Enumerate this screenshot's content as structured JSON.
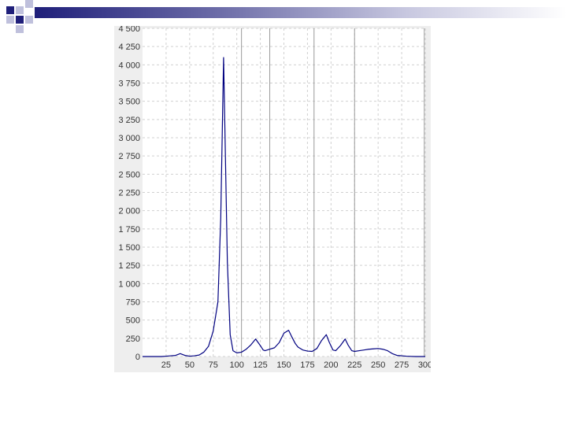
{
  "slide": {
    "decoration": "corner-squares-gradient-bar"
  },
  "colors": {
    "series_line": "#000080",
    "plot_background": "#ffffff",
    "panel_background": "#eeeeee",
    "grid": "#d0d0d0",
    "marker_line": "#999999",
    "decoration_dark": "#1f1f7a",
    "decoration_light": "#bfc0dc"
  },
  "chart_data": {
    "type": "line",
    "title": "",
    "xlabel": "",
    "ylabel": "",
    "xlim": [
      0,
      300
    ],
    "ylim": [
      0,
      4500
    ],
    "grid": true,
    "legend": "none",
    "x_ticks": [
      25,
      50,
      75,
      100,
      125,
      150,
      175,
      200,
      225,
      250,
      275,
      300
    ],
    "x_tick_labels": [
      "25",
      "50",
      "75",
      "100",
      "125",
      "150",
      "175",
      "200",
      "225",
      "250",
      "275",
      "300"
    ],
    "y_ticks": [
      0,
      250,
      500,
      750,
      1000,
      1250,
      1500,
      1750,
      2000,
      2250,
      2500,
      2750,
      3000,
      3250,
      3500,
      3750,
      4000,
      4250,
      4500
    ],
    "y_tick_labels": [
      "0",
      "250",
      "500",
      "750",
      "1 000",
      "1 250",
      "1 500",
      "1 750",
      "2 000",
      "2 250",
      "2 500",
      "2 750",
      "3 000",
      "3 250",
      "3 500",
      "3 750",
      "4 000",
      "4 250",
      "4 500"
    ],
    "vertical_markers": [
      105,
      135,
      182,
      225,
      299
    ],
    "series": [
      {
        "x": [
          0,
          10,
          20,
          25,
          30,
          35,
          40,
          45,
          50,
          55,
          60,
          65,
          70,
          75,
          80,
          83,
          86,
          88,
          90,
          93,
          96,
          100,
          105,
          110,
          115,
          120,
          125,
          128,
          130,
          135,
          140,
          145,
          150,
          155,
          158,
          162,
          165,
          170,
          175,
          180,
          185,
          190,
          195,
          198,
          202,
          205,
          210,
          215,
          218,
          222,
          225,
          230,
          235,
          240,
          245,
          250,
          255,
          260,
          265,
          270,
          275,
          280,
          285,
          290,
          295,
          300
        ],
        "y": [
          0,
          0,
          0,
          5,
          10,
          15,
          40,
          15,
          5,
          10,
          20,
          60,
          140,
          350,
          750,
          1900,
          4100,
          2700,
          1300,
          300,
          80,
          50,
          60,
          100,
          160,
          240,
          150,
          90,
          80,
          100,
          120,
          190,
          320,
          360,
          280,
          180,
          130,
          90,
          75,
          70,
          110,
          220,
          300,
          200,
          90,
          80,
          150,
          240,
          160,
          80,
          70,
          80,
          90,
          100,
          105,
          110,
          100,
          80,
          40,
          15,
          10,
          5,
          2,
          0,
          0,
          0
        ]
      }
    ]
  }
}
